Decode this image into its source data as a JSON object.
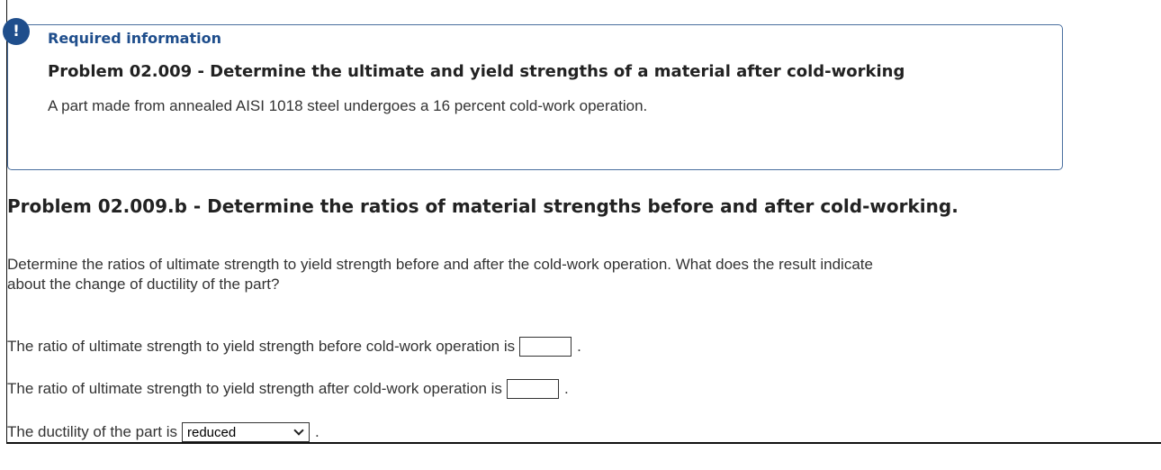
{
  "alert": {
    "glyph": "!"
  },
  "required_info": {
    "heading": "Required information",
    "problem_title": "Problem 02.009 - Determine the ultimate and yield strengths of a material after cold-working",
    "description": "A part made from annealed AISI 1018 steel undergoes a 16 percent cold-work operation."
  },
  "section": {
    "title": "Problem 02.009.b - Determine the ratios of material strengths before and after cold-working.",
    "question_line1": "Determine the ratios of ultimate strength to yield strength before and after the cold-work operation. What does the result indicate",
    "question_line2": "about the change of ductility of the part?"
  },
  "answers": {
    "before_label": "The ratio of ultimate strength to yield strength before cold-work operation is",
    "before_value": "",
    "after_label": "The ratio of ultimate strength to yield strength after cold-work operation is",
    "after_value": "",
    "ductility_label": "The ductility of the part is",
    "ductility_selected": "reduced",
    "period": "."
  },
  "colors": {
    "accent": "#1f4e8c",
    "border": "#4a6f9f"
  },
  "icons": {
    "alert": "exclamation-circle-icon",
    "dropdown": "chevron-down-icon"
  }
}
